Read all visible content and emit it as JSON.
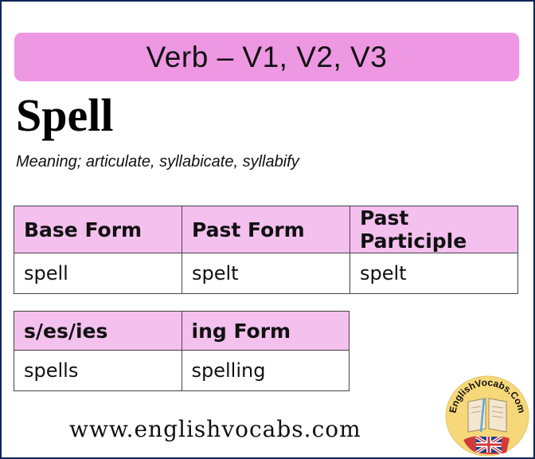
{
  "banner": {
    "title": "Verb – V1, V2, V3"
  },
  "word": "Spell",
  "meaning": "Meaning; articulate, syllabicate, syllabify",
  "table_forms": {
    "headers": [
      "Base Form",
      "Past Form",
      "Past Participle"
    ],
    "values": [
      "spell",
      "spelt",
      "spelt"
    ]
  },
  "table_other": {
    "headers": [
      "s/es/ies",
      "ing Form"
    ],
    "values": [
      "spells",
      "spelling"
    ]
  },
  "footer": {
    "url": "www.englishvocabs.com"
  },
  "logo": {
    "text": "EnglishVocabs.Com",
    "icons": [
      "open-book-icon",
      "uk-flag-icon"
    ]
  },
  "colors": {
    "banner": "#ee97e3",
    "header_cell": "#f4c0ee",
    "frame": "#0f2557",
    "logo_bg": "#f6d77a"
  }
}
